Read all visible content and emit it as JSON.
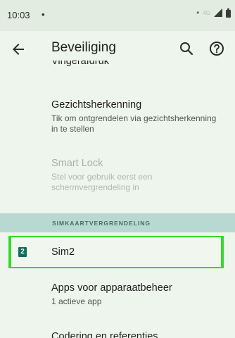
{
  "status_bar": {
    "time": "10:03",
    "dot": "•",
    "right_dot": "•",
    "network": "4G"
  },
  "app_bar": {
    "title": "Beveiliging",
    "back_icon": "arrow-back-icon",
    "search_icon": "search-icon",
    "help_icon": "help-icon"
  },
  "list": {
    "fingerprint_title": "Vingerafdruk",
    "face_title": "Gezichtsherkenning",
    "face_subtitle": "Tik om ontgrendelen via gezichtsherkenning in te stellen",
    "smartlock_title": "Smart Lock",
    "smartlock_subtitle": "Stel voor gebruik eerst een schermvergrendeling in",
    "section_header": "SIMKAARTVERGRENDELING",
    "sim_badge": "2",
    "sim_label": "Sim2",
    "device_admin_title": "Apps voor apparaatbeheer",
    "device_admin_subtitle": "1 actieve app",
    "encryption_title": "Codering en referenties"
  },
  "colors": {
    "background": "#eef5ec",
    "section_header_bg": "#b8d8d2",
    "highlight_border": "#35d82f",
    "sim_icon_bg": "#0e6f5d"
  }
}
